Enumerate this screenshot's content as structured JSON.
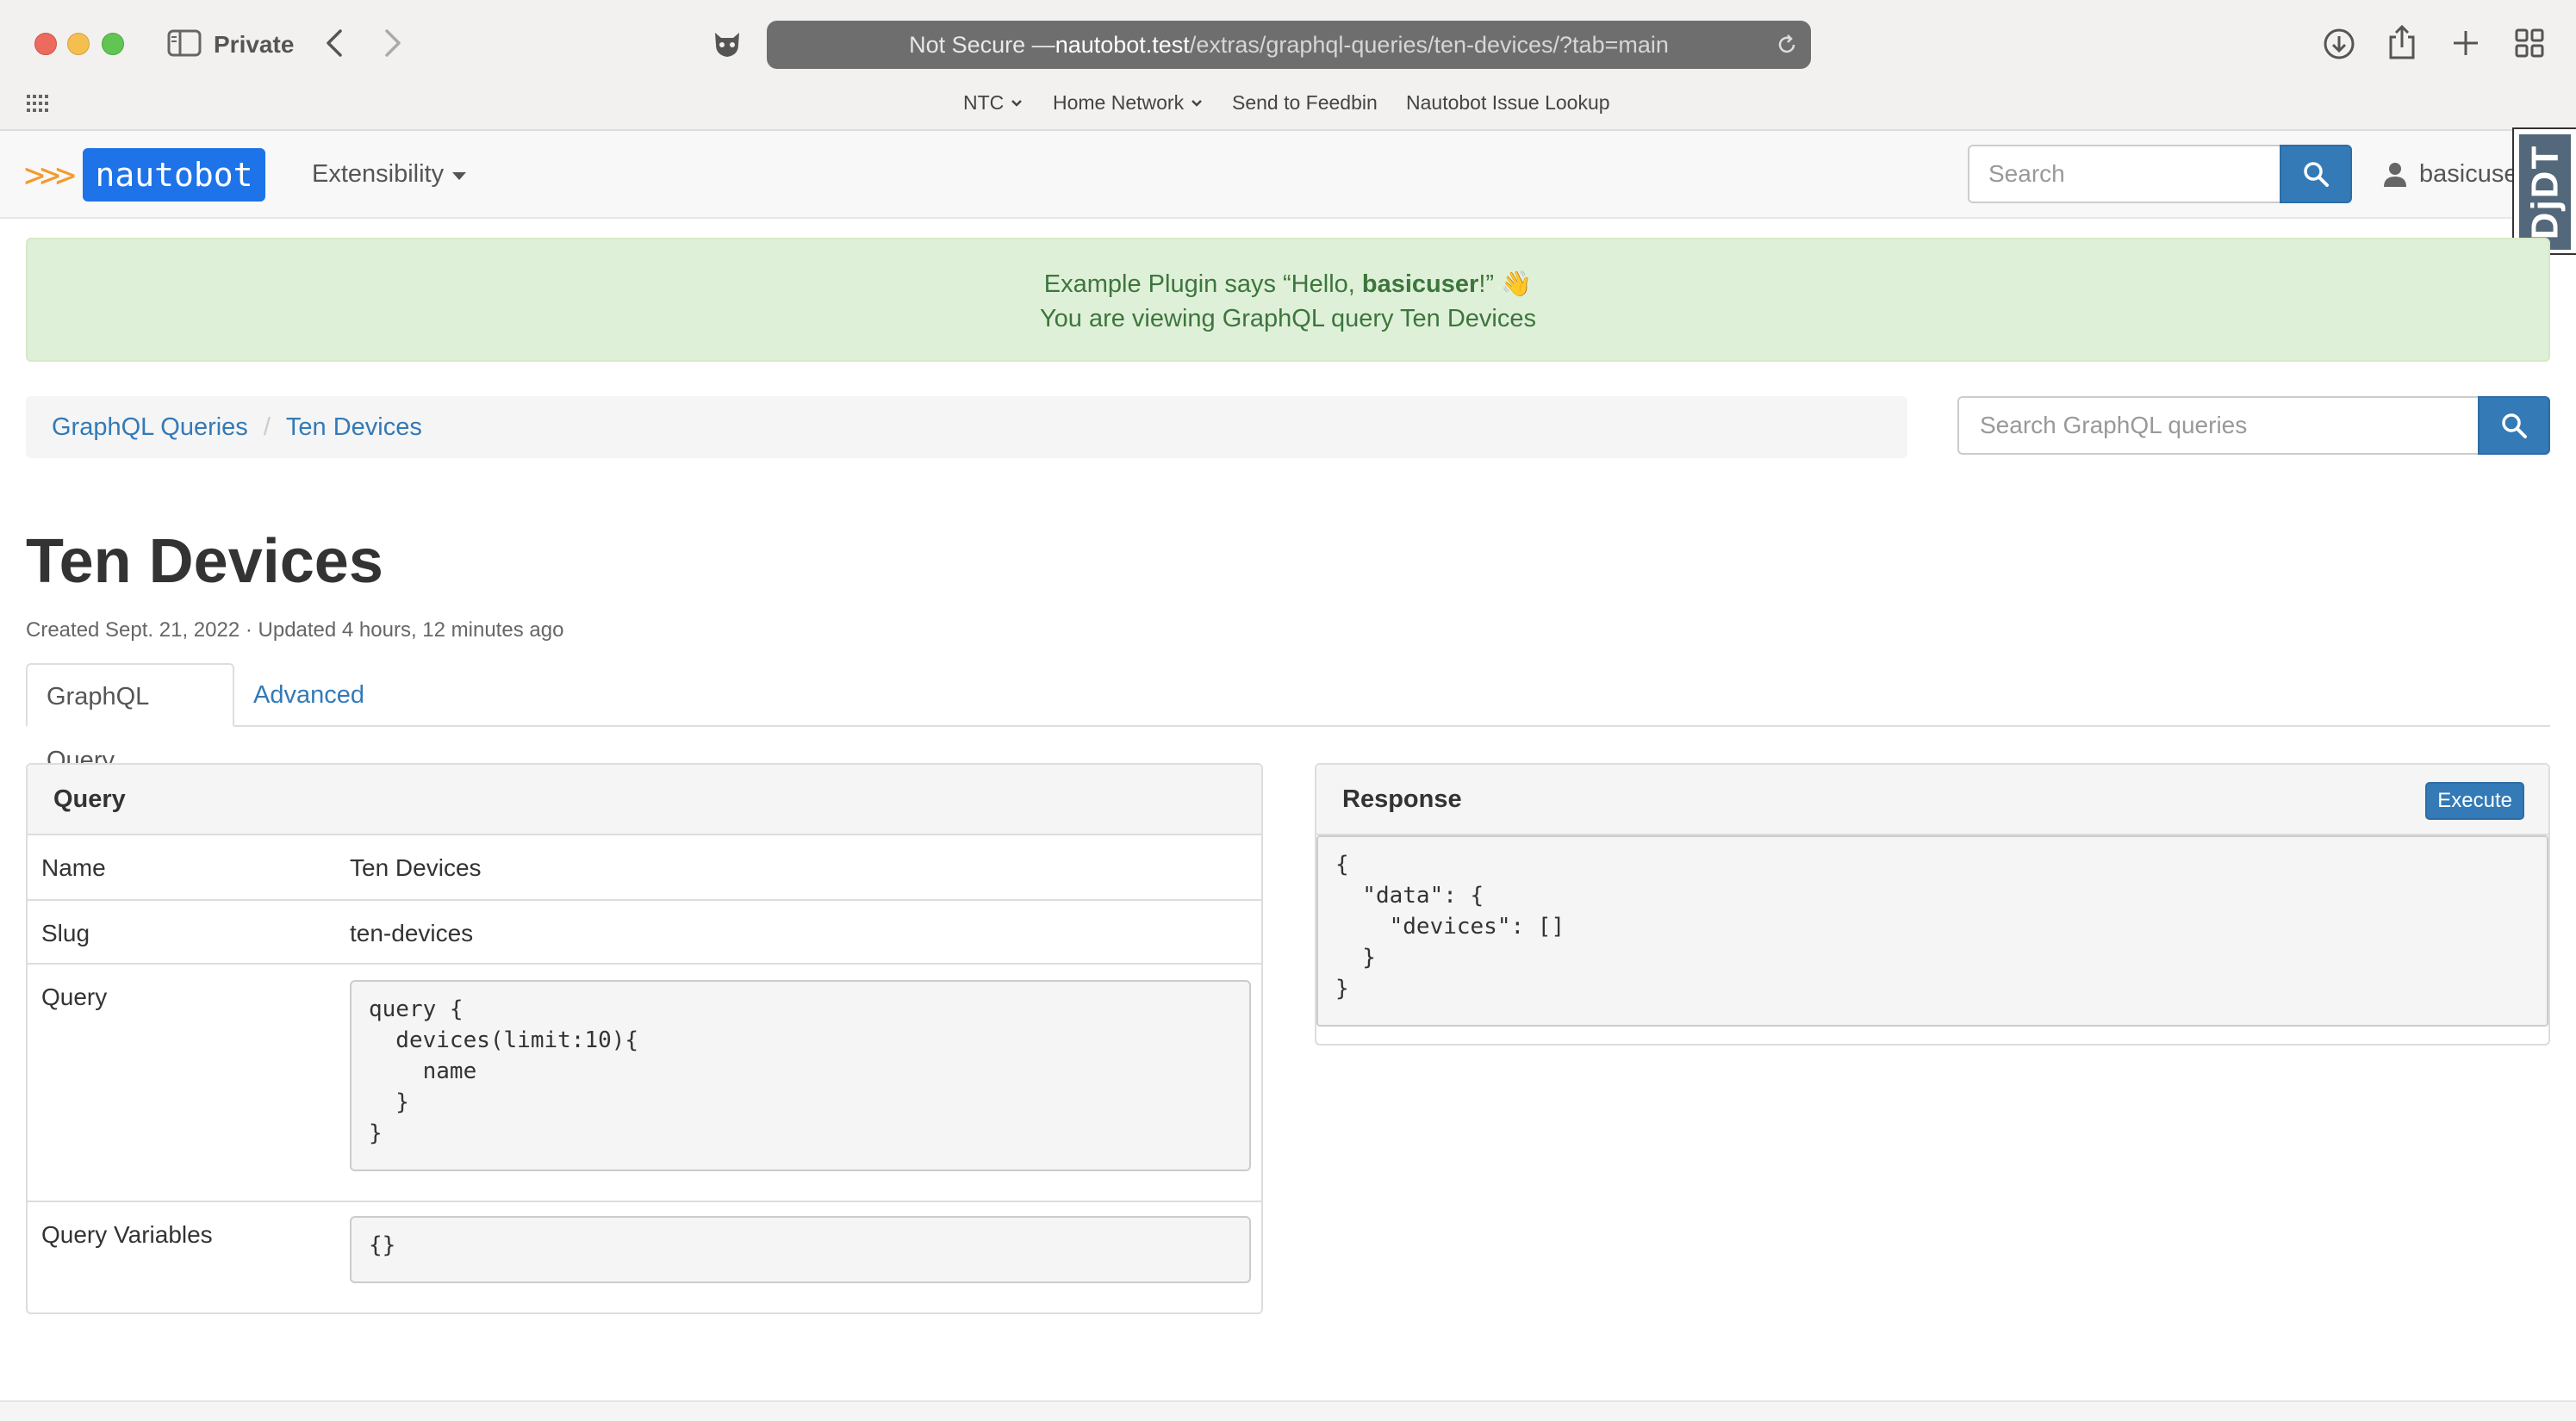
{
  "browser": {
    "private_label": "Private",
    "url_prefix": "Not Secure — ",
    "url_host": "nautobot.test",
    "url_path": "/extras/graphql-queries/ten-devices/?tab=main",
    "bookmarks": [
      {
        "label": "NTC",
        "dropdown": true
      },
      {
        "label": "Home Network",
        "dropdown": true
      },
      {
        "label": "Send to Feedbin",
        "dropdown": false
      },
      {
        "label": "Nautobot Issue Lookup",
        "dropdown": false
      }
    ]
  },
  "navbar": {
    "logo_text": "nautobot",
    "logo_chevrons": ">>>",
    "menu_label": "Extensibility",
    "search_placeholder": "Search",
    "username": "basicuser",
    "debug_toolbar": "DjDT",
    "brand_color": "#1e73e8",
    "accent_color": "#f29b2d"
  },
  "alert": {
    "prefix": "Example Plugin says “Hello, ",
    "user": "basicuser",
    "suffix": "!” 👋",
    "line2": "You are viewing GraphQL query Ten Devices"
  },
  "breadcrumb": {
    "items": [
      "GraphQL Queries",
      "Ten Devices"
    ],
    "separator": "/"
  },
  "search_queries_placeholder": "Search GraphQL queries",
  "page": {
    "title": "Ten Devices",
    "meta": "Created Sept. 21, 2022 · Updated 4 hours, 12 minutes ago"
  },
  "tabs": [
    {
      "label": "GraphQL Query",
      "active": true
    },
    {
      "label": "Advanced",
      "active": false
    }
  ],
  "query_panel": {
    "heading": "Query",
    "rows": [
      {
        "key": "Name",
        "value": "Ten Devices"
      },
      {
        "key": "Slug",
        "value": "ten-devices"
      },
      {
        "key": "Query",
        "value": "query {\n  devices(limit:10){\n    name\n  }\n}"
      },
      {
        "key": "Query Variables",
        "value": "{}"
      }
    ]
  },
  "response_panel": {
    "heading": "Response",
    "execute_label": "Execute",
    "body": "{\n  \"data\": {\n    \"devices\": []\n  }\n}"
  }
}
